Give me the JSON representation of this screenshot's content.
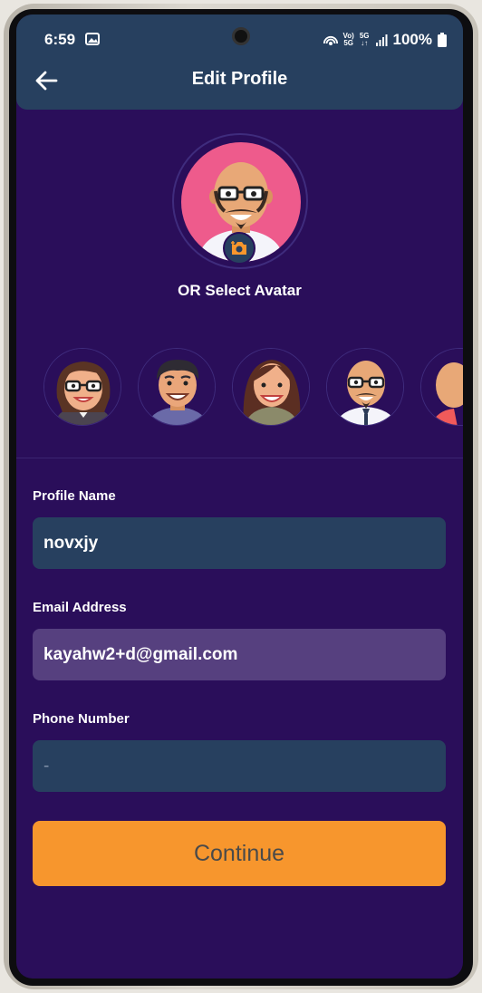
{
  "status": {
    "time": "6:59",
    "battery": "100%",
    "net_top": "Vo)",
    "net_bottom": "5G",
    "net2_top": "5G",
    "net2_bottom": "↓↑"
  },
  "header": {
    "title": "Edit Profile"
  },
  "avatar_section": {
    "select_label": "OR Select Avatar",
    "avatars": [
      "woman-glasses-avatar",
      "man-smiling-avatar",
      "woman-long-hair-avatar",
      "bald-man-glasses-avatar",
      "partial-avatar"
    ]
  },
  "form": {
    "name_label": "Profile Name",
    "name_value": "novxjy",
    "email_label": "Email Address",
    "email_value": "kayahw2+d@gmail.com",
    "phone_label": "Phone Number",
    "phone_value": "-"
  },
  "actions": {
    "continue_label": "Continue"
  },
  "colors": {
    "background": "#2a0e5a",
    "header": "#27405f",
    "field": "#27405f",
    "field_disabled": "#56407f",
    "accent": "#f7962d",
    "avatar_bg": "#ee5b8c"
  }
}
